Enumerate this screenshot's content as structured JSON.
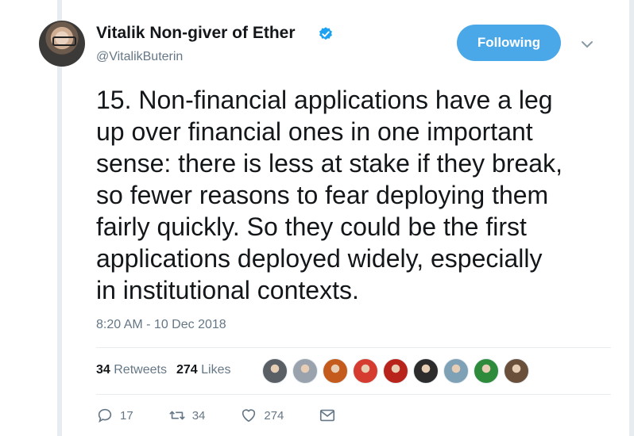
{
  "author": {
    "name": "Vitalik Non-giver of Ether",
    "handle": "@VitalikButerin"
  },
  "follow_button_label": "Following",
  "tweet": {
    "text": "15. Non-financial applications have a leg\nup over financial ones in one important\nsense: there is less at stake if they break,\nso fewer reasons to fear deploying them\nfairly quickly. So they could be the first\napplications deployed widely, especially\nin institutional contexts.",
    "timestamp": "8:20 AM - 10 Dec 2018"
  },
  "stats": {
    "retweets_count": "34",
    "retweets_label": "Retweets",
    "likes_count": "274",
    "likes_label": "Likes"
  },
  "likers": [
    {
      "color": "#5a5f66"
    },
    {
      "color": "#9aa3ad"
    },
    {
      "color": "#c45b1c"
    },
    {
      "color": "#d63b2f"
    },
    {
      "color": "#b8231b"
    },
    {
      "color": "#2c2c2c"
    },
    {
      "color": "#7fa1b5"
    },
    {
      "color": "#2e8b3c"
    },
    {
      "color": "#6a4f3b"
    }
  ],
  "actions": {
    "reply_count": "17",
    "retweet_count": "34",
    "like_count": "274"
  },
  "colors": {
    "accent": "#1da1f2",
    "follow_bg": "#4aa8e8",
    "muted_text": "#657786"
  }
}
